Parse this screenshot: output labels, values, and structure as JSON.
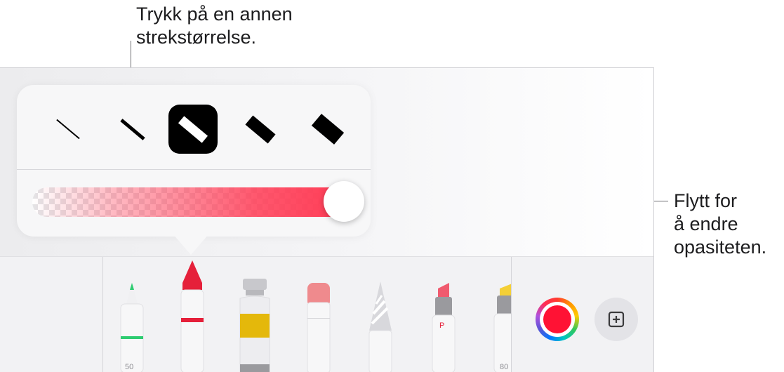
{
  "callouts": {
    "stroke_size": "Trykk på en annen\nstrekstørrelse.",
    "opacity": "Flytt for\nå endre\nopasiteten."
  },
  "popover": {
    "stroke_sizes": [
      "thinnest",
      "thin",
      "medium",
      "thick",
      "thickest"
    ],
    "selected_stroke_index": 2,
    "opacity_value": 1.0,
    "opacity_color": "#ff3b55"
  },
  "toolbar": {
    "tools": [
      "pen",
      "crayon",
      "paint-tube",
      "eraser",
      "pencil",
      "marker",
      "highlighter"
    ],
    "selected_tool": "crayon",
    "pen_width_label": "50",
    "highlighter_opacity_label": "80",
    "current_color": "#ff1234",
    "pen_color": "#2ecc71",
    "crayon_color": "#e5203a",
    "paint_color": "#e4b80b"
  }
}
